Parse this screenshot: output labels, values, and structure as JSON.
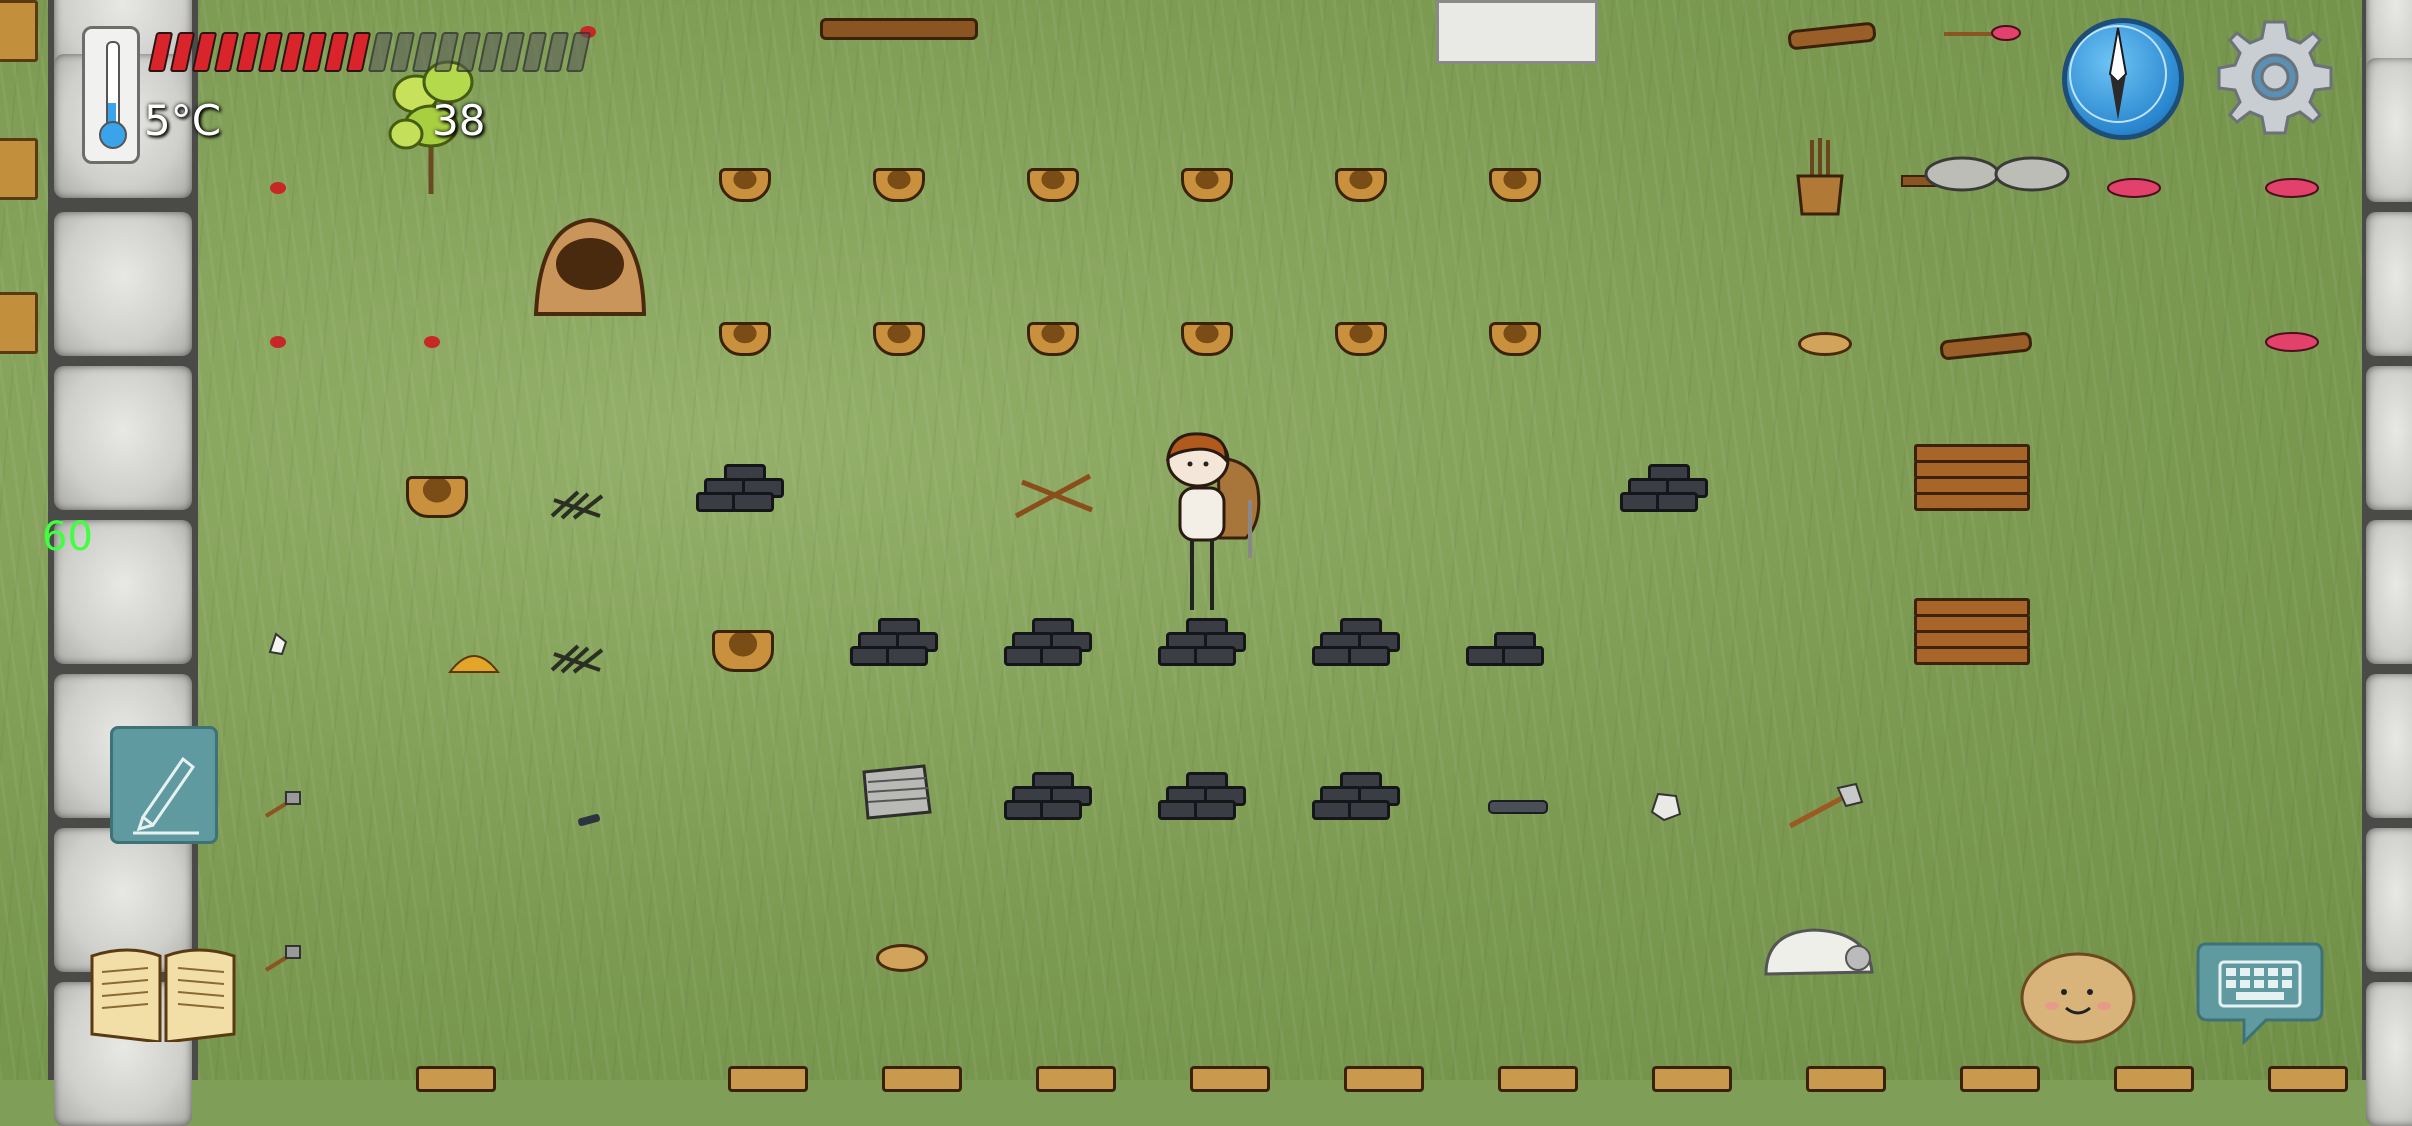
{
  "hud": {
    "temperature": "5°C",
    "food_pips_full": 10,
    "food_pips_total": 20,
    "age": "38",
    "fps": "60"
  },
  "icons": {
    "thermometer": "thermometer-icon",
    "compass": "compass-icon",
    "settings": "gear-icon",
    "notes": "pencil-icon",
    "tech_tree": "book-icon",
    "emote": "potato-face-icon",
    "chat": "keyboard-icon"
  },
  "colors": {
    "grass": "#7f9e57",
    "food_full": "#d8242a",
    "fps_text": "#3fff3f",
    "compass_blue": "#2a87cf"
  }
}
